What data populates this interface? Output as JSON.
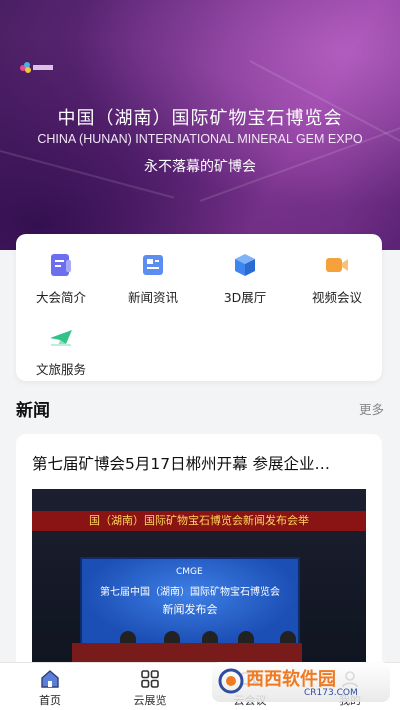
{
  "hero": {
    "title": "中国（湖南）国际矿物宝石博览会",
    "subtitle": "CHINA (HUNAN) INTERNATIONAL MINERAL GEM EXPO",
    "slogan": "永不落幕的矿博会"
  },
  "services": [
    {
      "label": "大会简介",
      "icon": "document-icon",
      "color": "#6b6ef0"
    },
    {
      "label": "新闻资讯",
      "icon": "newspaper-icon",
      "color": "#5b8ef0"
    },
    {
      "label": "3D展厅",
      "icon": "cube-icon",
      "color": "#3d86f0"
    },
    {
      "label": "视频会议",
      "icon": "video-icon",
      "color": "#f5a13b"
    },
    {
      "label": "文旅服务",
      "icon": "plane-icon",
      "color": "#33c28a"
    }
  ],
  "news": {
    "section_title": "新闻",
    "more": "更多",
    "headline": "第七届矿博会5月17日郴州开幕 参展企业…",
    "photo": {
      "banner": "国（湖南）国际矿物宝石博览会新闻发布会举",
      "screen_logo": "CMGE",
      "screen_line1": "第七届中国（湖南）国际矿物宝石博览会",
      "screen_line2": "新闻发布会"
    }
  },
  "tabbar": {
    "tabs": [
      {
        "label": "首页",
        "icon": "home-icon",
        "active": true
      },
      {
        "label": "云展览",
        "icon": "grid-icon",
        "active": false
      },
      {
        "label": "云会议",
        "icon": "meeting-icon",
        "active": false
      },
      {
        "label": "我的",
        "icon": "user-icon",
        "active": false
      }
    ]
  },
  "watermark": {
    "text": "西西软件园",
    "url": "CR173.COM"
  },
  "colors": {
    "hero_purple": "#6a2b82",
    "accent_orange": "#f07a22"
  }
}
